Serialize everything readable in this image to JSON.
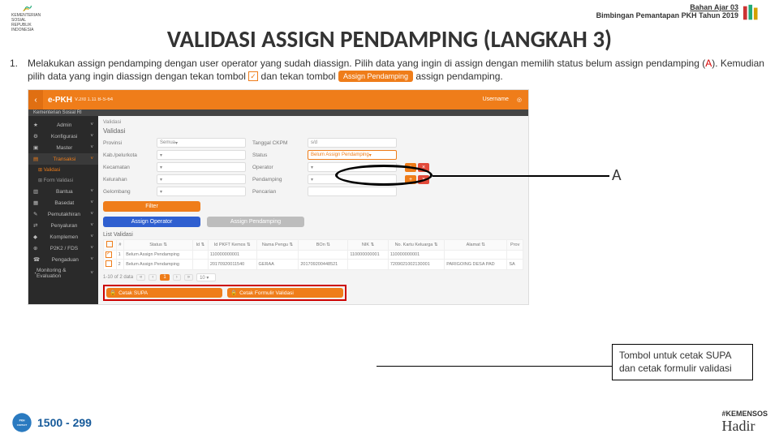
{
  "doc": {
    "header_line1": "Bahan Ajar 03",
    "header_line2": "Bimbingan Pemantapan PKH Tahun 2019",
    "title": "VALIDASI ASSIGN PENDAMPING (LANGKAH 3)",
    "list_number": "1.",
    "body_part1": "Melakukan assign pendamping dengan user operator yang sudah diassign. Pilih data yang ingin di assign dengan memilih status belum assign pendamping (",
    "body_A": "A",
    "body_part2": "). Kemudian pilih data yang ingin diassign  dengan tekan tombol ",
    "body_part3": " dan tekan tombol ",
    "body_inline_btn": "Assign Pendamping",
    "body_part4": " assign pendamping.",
    "label_A": "A",
    "callout": "Tombol untuk cetak SUPA dan cetak formulir validasi",
    "logo_left_caption": "KEMENTERIAN SOSIAL\nREPUBLIK INDONESIA",
    "contact": "1500 - 299",
    "hadir_tag": "#KEMENSOS",
    "hadir_script": "Hadir"
  },
  "app": {
    "breadcrumb_left": "Kementerian Sosial RI",
    "brand": "e-PKH",
    "version": "V.2rd 1.11 B-S-64",
    "top_right": [
      "Username",
      "◎"
    ],
    "sidebar": [
      {
        "label": "Admin",
        "type": "grp"
      },
      {
        "label": "Konfigurasi",
        "type": "grp"
      },
      {
        "label": "Master",
        "type": "grp"
      },
      {
        "label": "Transaksi",
        "type": "grp",
        "active": true
      },
      {
        "label": "Validasi",
        "type": "sub",
        "sel": true
      },
      {
        "label": "Form Validasi",
        "type": "sub"
      },
      {
        "label": "Bantua",
        "type": "grp"
      },
      {
        "label": "Basedat",
        "type": "grp"
      },
      {
        "label": "Pemutakhiran",
        "type": "grp"
      },
      {
        "label": "Penyaluran",
        "type": "grp"
      },
      {
        "label": "Komplemen",
        "type": "grp"
      },
      {
        "label": "P2K2 / FDS",
        "type": "grp"
      },
      {
        "label": "Pengaduan",
        "type": "grp"
      },
      {
        "label": "Monitoring & Evaluation",
        "type": "grp"
      }
    ],
    "crumb": "Validasi",
    "panel_title": "Validasi",
    "form": {
      "provinsi_label": "Provinsi",
      "provinsi_val": "Semua",
      "tanggal_label": "Tanggal CKPM",
      "tanggal_val": "s/d",
      "kab_label": "Kab./pelurkota",
      "status_label": "Status",
      "status_val": "Belum Assign Pendamping",
      "kec_label": "Kecamatan",
      "operator_label": "Operator",
      "kel_label": "Kelurahan",
      "pendamping_label": "Pendamping",
      "gelombang_label": "Gelombang",
      "pencarian_label": "Pencarian"
    },
    "actions": {
      "filter": "Filter",
      "op": "Assign Operator",
      "pd": "Assign Pendamping"
    },
    "list_title": "List Validasi",
    "table": {
      "headers": [
        "",
        "#",
        "Status ⇅",
        "Id ⇅",
        "Id PKFT Kemos ⇅",
        "Nama Pengu ⇅",
        "BOn ⇅",
        "NIK ⇅",
        "No. Kartu Keluarga ⇅",
        "Alamat ⇅",
        "Prov"
      ],
      "rows": [
        {
          "chk": true,
          "n": "1",
          "status": "Belum Assign Pendamping",
          "id": "",
          "idp": "110000000001",
          "nama": "",
          "bon": "",
          "nik": "110000000001",
          "kk": "110000000001",
          "alamat": "",
          "prov": ""
        },
        {
          "chk": false,
          "n": "2",
          "status": "Belum Assign Pendamping",
          "id": "",
          "idp": "20170920011540",
          "nama": "GERAA",
          "bon": "201709200448521",
          "nik": "",
          "kk": "7209021002130001",
          "alamat": "PARIGOING DESA PAD",
          "prov": "SA"
        }
      ]
    },
    "pager": {
      "info": "1-10 of 2 data",
      "pages": [
        "«",
        "‹",
        "1",
        "›",
        "»"
      ],
      "per": "10 ▾"
    },
    "print": {
      "supa": "Cetak SUPA",
      "form": "Cetak Formulir Validasi"
    }
  }
}
